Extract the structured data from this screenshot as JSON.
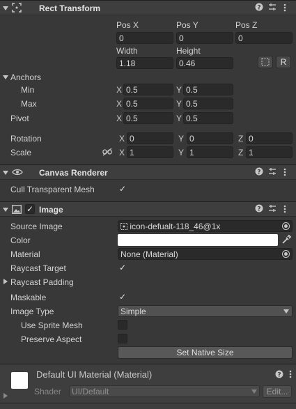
{
  "rect_transform": {
    "title": "Rect Transform",
    "pos_x_label": "Pos X",
    "pos_y_label": "Pos Y",
    "pos_z_label": "Pos Z",
    "pos_x": "0",
    "pos_y": "0",
    "pos_z": "0",
    "width_label": "Width",
    "height_label": "Height",
    "width": "1.18",
    "height": "0.46",
    "r_button": "R",
    "anchors_label": "Anchors",
    "min_label": "Min",
    "max_label": "Max",
    "min_x": "0.5",
    "min_y": "0.5",
    "max_x": "0.5",
    "max_y": "0.5",
    "pivot_label": "Pivot",
    "pivot_x": "0.5",
    "pivot_y": "0.5",
    "rotation_label": "Rotation",
    "rot_x": "0",
    "rot_y": "0",
    "rot_z": "0",
    "scale_label": "Scale",
    "scale_x": "1",
    "scale_y": "1",
    "scale_z": "1",
    "axis_x": "X",
    "axis_y": "Y",
    "axis_z": "Z"
  },
  "canvas_renderer": {
    "title": "Canvas Renderer",
    "cull_label": "Cull Transparent Mesh",
    "cull_checked": "✓"
  },
  "image": {
    "title": "Image",
    "enabled_check": "✓",
    "source_image_label": "Source Image",
    "source_image_value": "icon-defualt-118_46@1x",
    "color_label": "Color",
    "color_value": "#ffffff",
    "material_label": "Material",
    "material_value": "None (Material)",
    "raycast_target_label": "Raycast Target",
    "raycast_target_check": "✓",
    "raycast_padding_label": "Raycast Padding",
    "maskable_label": "Maskable",
    "maskable_check": "✓",
    "image_type_label": "Image Type",
    "image_type_value": "Simple",
    "use_sprite_mesh_label": "Use Sprite Mesh",
    "preserve_aspect_label": "Preserve Aspect",
    "set_native_size_button": "Set Native Size"
  },
  "material": {
    "title": "Default UI Material (Material)",
    "shader_label": "Shader",
    "shader_value": "UI/Default",
    "edit_button": "Edit..."
  },
  "header_icons": [
    "help-icon",
    "preset-icon",
    "more-icon"
  ],
  "colors": {
    "panel_bg": "#383838",
    "header_bg": "#3e3e3e",
    "field_bg": "#2a2a2a",
    "button_bg": "#585858",
    "color_swatch": "#ffffff"
  }
}
